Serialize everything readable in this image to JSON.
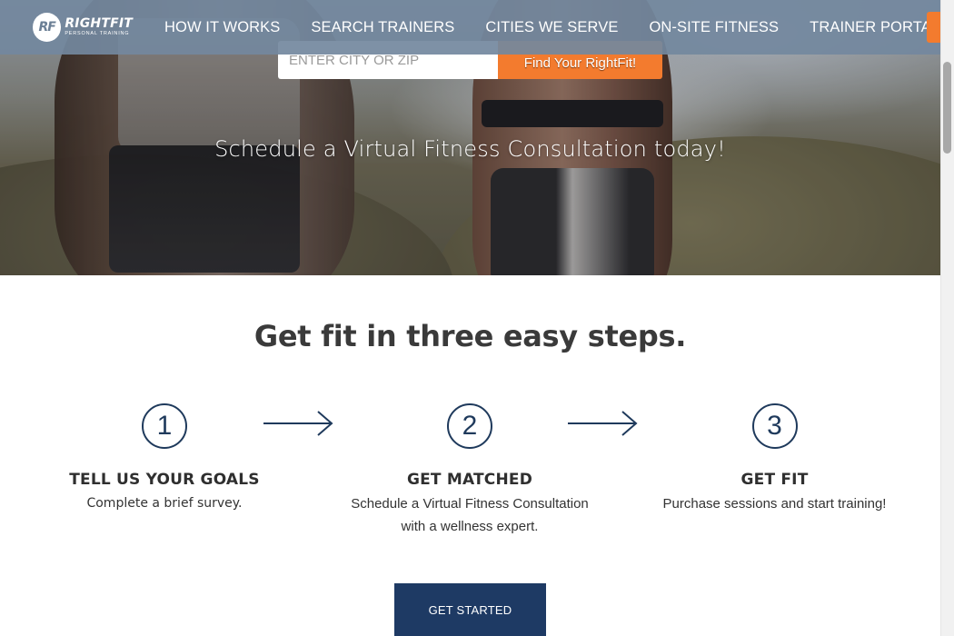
{
  "brand": {
    "logo_mark": "RF",
    "logo_word": "RIGHTFIT",
    "logo_sub": "PERSONAL TRAINING"
  },
  "nav": {
    "links": [
      "HOW IT WORKS",
      "SEARCH TRAINERS",
      "CITIES WE SERVE",
      "ON-SITE FITNESS",
      "TRAINER PORTAL"
    ],
    "accent_color": "#f37b2e"
  },
  "hero": {
    "search_placeholder": "ENTER CITY OR ZIP",
    "search_value": "",
    "search_button": "Find Your RightFit!",
    "tagline": "Schedule a Virtual Fitness Consultation today!"
  },
  "steps": {
    "title": "Get fit in three easy steps.",
    "items": [
      {
        "number": "1",
        "title": "TELL US YOUR GOALS",
        "desc_line1": "Complete a brief survey.",
        "desc_line2": ""
      },
      {
        "number": "2",
        "title": "GET MATCHED",
        "desc_line1": "Schedule a Virtual Fitness Consultation",
        "desc_line2": "with a wellness expert."
      },
      {
        "number": "3",
        "title": "GET FIT",
        "desc_line1": "Purchase sessions and start training!",
        "desc_line2": ""
      }
    ],
    "cta": "GET STARTED"
  },
  "colors": {
    "navy": "#1e3a64",
    "orange": "#f37b2e",
    "nav_bg": "#73889e"
  },
  "icons": [
    "arrow-right-icon",
    "logo-icon"
  ]
}
